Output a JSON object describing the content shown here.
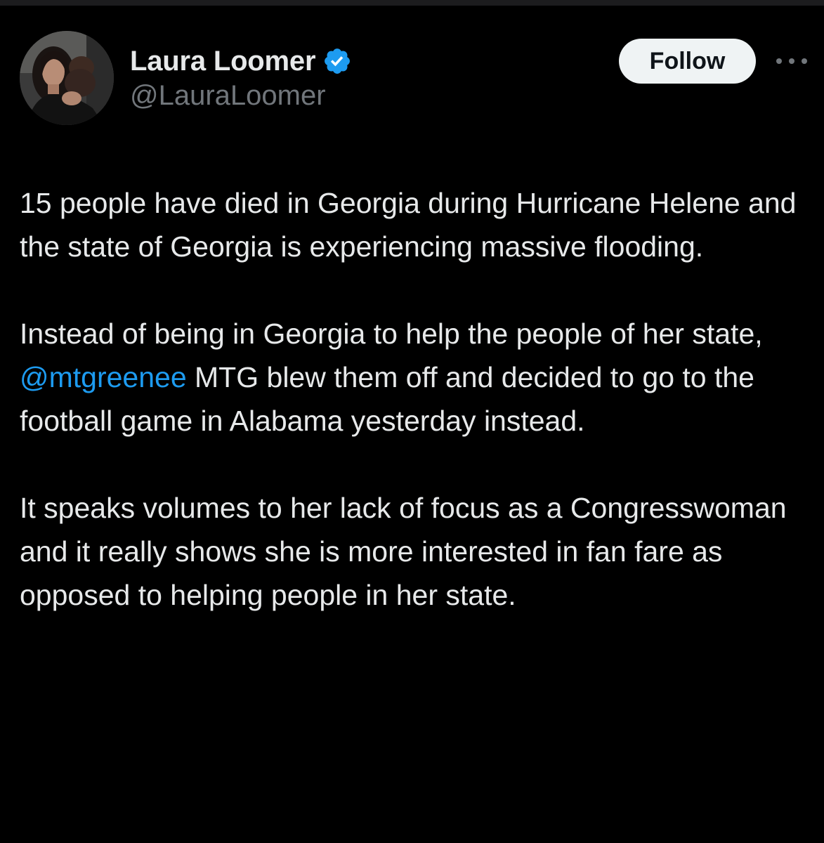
{
  "author": {
    "display_name": "Laura Loomer",
    "handle": "@LauraLoomer",
    "verified": true,
    "avatar": "avatar-photo"
  },
  "actions": {
    "follow_label": "Follow",
    "more_icon": "more-horizontal-icon"
  },
  "tweet": {
    "paragraph1": "15 people have died in Georgia during Hurricane Helene and the state of Georgia is experiencing massive flooding.",
    "paragraph2_before": "Instead of being in Georgia to help the people of her state, ",
    "paragraph2_mention": "@mtgreenee",
    "paragraph2_after": " MTG blew them off and decided to go to the football game in Alabama yesterday instead.",
    "paragraph3": "It speaks volumes to her lack of focus as a Congresswoman and it really shows she is more interested in fan fare as opposed to helping people in her state."
  },
  "colors": {
    "background": "#000000",
    "text": "#e7e9ea",
    "secondary_text": "#71767b",
    "link": "#1d9bf0",
    "verified_badge": "#1d9bf0",
    "follow_button_bg": "#eff3f4",
    "follow_button_text": "#0f1419"
  }
}
